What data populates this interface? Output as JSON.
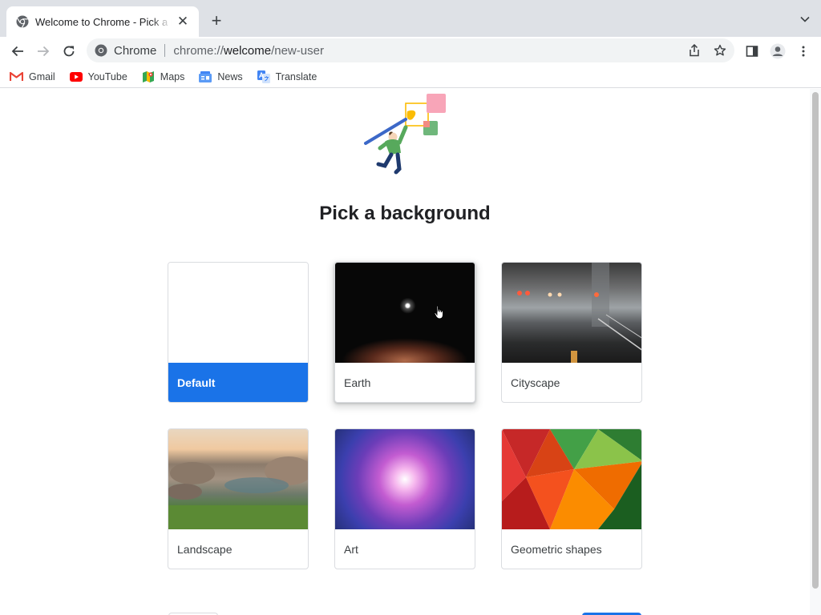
{
  "tab": {
    "title": "Welcome to Chrome - Pick a background",
    "close": "✕",
    "new_tab": "+"
  },
  "omnibox": {
    "chip": "Chrome",
    "url_scheme": "chrome://",
    "url_host": "welcome",
    "url_path": "/new-user"
  },
  "bookmarks": [
    {
      "label": "Gmail",
      "icon": "gmail-icon"
    },
    {
      "label": "YouTube",
      "icon": "youtube-icon"
    },
    {
      "label": "Maps",
      "icon": "maps-icon"
    },
    {
      "label": "News",
      "icon": "news-icon"
    },
    {
      "label": "Translate",
      "icon": "translate-icon"
    }
  ],
  "page": {
    "heading": "Pick a background",
    "backgrounds": [
      {
        "label": "Default",
        "selected": true
      },
      {
        "label": "Earth",
        "selected": false
      },
      {
        "label": "Cityscape",
        "selected": false
      },
      {
        "label": "Landscape",
        "selected": false
      },
      {
        "label": "Art",
        "selected": false
      },
      {
        "label": "Geometric shapes",
        "selected": false
      }
    ]
  },
  "colors": {
    "accent": "#1a73e8",
    "tabstrip": "#dee1e6",
    "omnibox": "#f1f3f4"
  }
}
